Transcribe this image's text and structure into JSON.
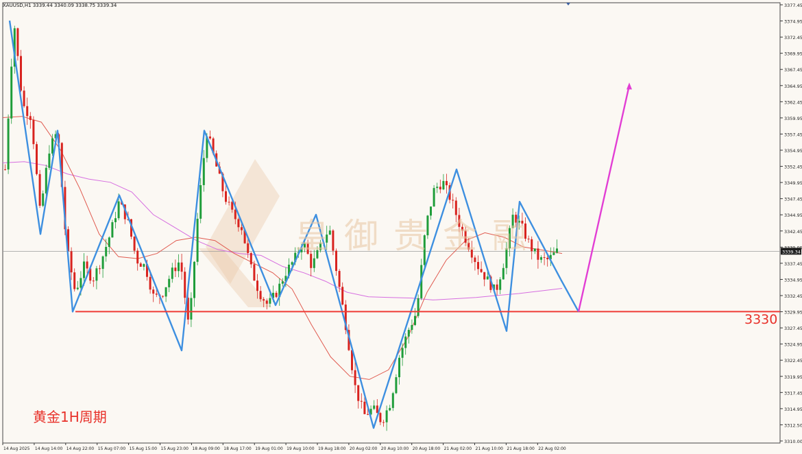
{
  "chart_data": {
    "type": "candlestick",
    "symbol_header": "XAUUSD,H1  3339.44 3340.09 3338.75 3339.34",
    "price_axis": {
      "min": 3310.0,
      "max": 3377.45,
      "ticks": [
        "3377.45",
        "3374.95",
        "3372.45",
        "3369.95",
        "3367.45",
        "3364.95",
        "3362.45",
        "3359.95",
        "3357.45",
        "3354.95",
        "3352.45",
        "3349.95",
        "3347.45",
        "3344.95",
        "3342.45",
        "3339.95",
        "3337.45",
        "3334.95",
        "3332.45",
        "3329.95",
        "3327.45",
        "3324.95",
        "3322.45",
        "3319.95",
        "3317.45",
        "3314.95",
        "3312.50",
        "3310.00"
      ]
    },
    "time_axis": {
      "ticks": [
        "14 Aug 2025",
        "14 Aug 14:00",
        "14 Aug 22:00",
        "15 Aug 07:00",
        "15 Aug 15:00",
        "15 Aug 23:00",
        "18 Aug 09:00",
        "18 Aug 17:00",
        "19 Aug 01:00",
        "19 Aug 10:00",
        "19 Aug 18:00",
        "20 Aug 02:00",
        "20 Aug 10:00",
        "20 Aug 18:00",
        "21 Aug 02:00",
        "21 Aug 10:00",
        "21 Aug 18:00",
        "22 Aug 02:00"
      ]
    },
    "current_price": "3339.34",
    "support_level": {
      "value": 3330,
      "label": "3330"
    },
    "zigzag": [
      3375,
      3342,
      3358,
      3330,
      3348,
      3324,
      3358,
      3331,
      3345,
      3312,
      3352,
      3327,
      3347,
      3335
    ],
    "projection": [
      3335,
      3330,
      3365
    ],
    "ma_fast": [
      3360,
      3360.2,
      3359.3,
      3355,
      3349,
      3342,
      3338.5,
      3338.2,
      3339,
      3341,
      3341.5,
      3341,
      3339,
      3337.5,
      3336,
      3333.5,
      3328,
      3323,
      3320,
      3319.5,
      3321,
      3326,
      3333,
      3338,
      3341,
      3342.2,
      3341.5,
      3340,
      3339.5,
      3339
    ],
    "ma_slow": [
      3353,
      3353.2,
      3352.6,
      3351.3,
      3350.5,
      3350,
      3348.5,
      3345,
      3343,
      3341,
      3339.6,
      3339,
      3338.7,
      3337,
      3336,
      3334.7,
      3333,
      3332.3,
      3332.2,
      3332.1,
      3331.8,
      3332,
      3332.2,
      3332.5,
      3332.8,
      3333.2,
      3333.6
    ],
    "candle_profile": [
      3352,
      3375,
      3362,
      3360,
      3345,
      3355,
      3358,
      3340,
      3333,
      3337,
      3335,
      3338,
      3342,
      3347,
      3344,
      3338,
      3337,
      3332,
      3333,
      3336,
      3338,
      3327,
      3345,
      3358,
      3353,
      3348,
      3345,
      3343,
      3337,
      3333,
      3331,
      3333,
      3336,
      3338,
      3341,
      3337,
      3340,
      3343,
      3335,
      3327,
      3318,
      3314,
      3315,
      3313,
      3316,
      3323,
      3327,
      3330,
      3343,
      3349,
      3350,
      3347,
      3343,
      3340,
      3337,
      3335,
      3333,
      3338,
      3345,
      3343,
      3340,
      3338,
      3338,
      3339.3
    ],
    "labels": {
      "chinese": "黄金1H周期",
      "watermark": "皇御贵金融"
    },
    "colors": {
      "background": "#fbf8f3",
      "bull": "#1f9d3a",
      "bear": "#d8231f",
      "zigzag": "#3d8fe0",
      "projection": "#e23ed4",
      "support": "#ef3b36",
      "ma_fast": "#e05a4f",
      "ma_slow": "#d66de0",
      "price_label_bg": "#1d1d1d"
    }
  }
}
